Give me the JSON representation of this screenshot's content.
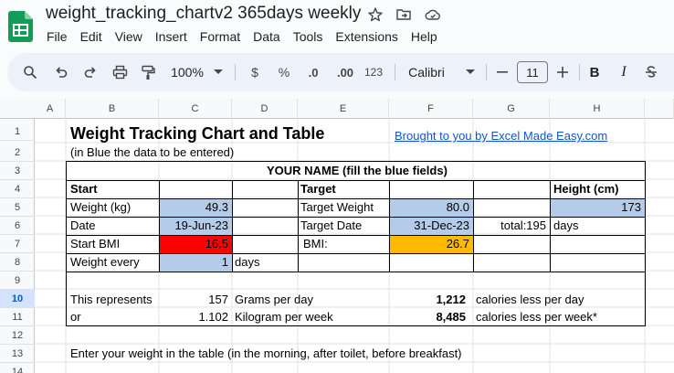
{
  "doc": {
    "title": "weight_tracking_chartv2 365days weekly",
    "menu": [
      "File",
      "Edit",
      "View",
      "Insert",
      "Format",
      "Data",
      "Tools",
      "Extensions",
      "Help"
    ]
  },
  "toolbar": {
    "zoom": "100%",
    "currency": "$",
    "percent": "%",
    "dec_decrease": ".0",
    "dec_increase": ".00",
    "number_format": "123",
    "font": "Calibri",
    "font_size": "11",
    "bold": "B",
    "italic": "I"
  },
  "columns": [
    "A",
    "B",
    "C",
    "D",
    "E",
    "F",
    "G",
    "H"
  ],
  "rows": [
    "1",
    "2",
    "3",
    "4",
    "5",
    "6",
    "7",
    "8",
    "9",
    "10",
    "11",
    "12",
    "13",
    "14"
  ],
  "sheet": {
    "title": "Weight Tracking Chart and Table",
    "link": "Brought to you by Excel Made Easy.com",
    "subtitle": "(in Blue the data to be entered)",
    "your_name": "YOUR NAME (fill the blue fields)",
    "start_header": "Start",
    "target_header": "Target",
    "height_header": "Height (cm)",
    "weight_label": "Weight (kg)",
    "weight_value": "49.3",
    "target_weight_label": "Target Weight",
    "target_weight_value": "80.0",
    "height_value": "173",
    "date_label": "Date",
    "date_value": "19-Jun-23",
    "target_date_label": "Target Date",
    "target_date_value": "31-Dec-23",
    "total_label": "total:195",
    "days_label": "days",
    "start_bmi_label": "Start BMI",
    "start_bmi_value": "16.5",
    "bmi_label": "BMI:",
    "bmi_value": "26.7",
    "weight_every_label": "Weight every",
    "weight_every_value": "1",
    "weight_every_unit": "days",
    "represents_label": "This represents",
    "grams_value": "157",
    "grams_label": "Grams per day",
    "cal_day_value": "1,212",
    "cal_day_label": "calories less per day",
    "or_label": "or",
    "kg_value": "1.102",
    "kg_label": "Kilogram per week",
    "cal_week_value": "8,485",
    "cal_week_label": "calories less per week*",
    "instruction": "Enter your weight in the table (in the morning, after toilet, before breakfast)"
  },
  "colors": {
    "blue_fill": "#b4cce9",
    "red_fill": "#ff0000",
    "orange_fill": "#ffba00",
    "link": "#1155cc"
  }
}
